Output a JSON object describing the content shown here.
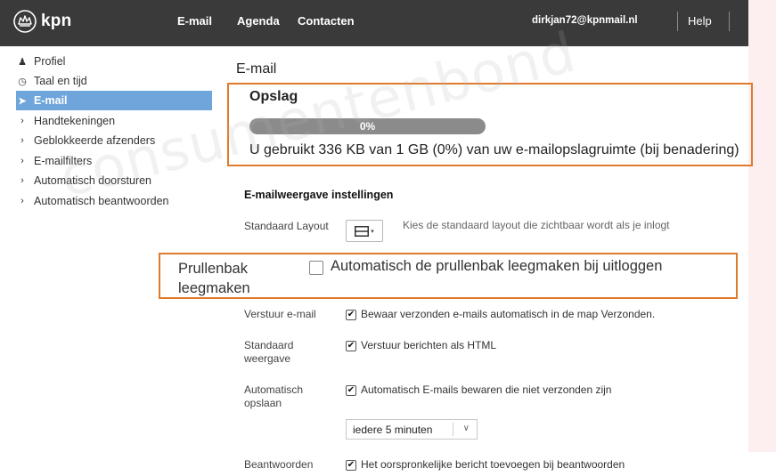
{
  "header": {
    "logo_text": "kpn",
    "nav": [
      "E-mail",
      "Agenda",
      "Contacten"
    ],
    "user_email": "dirkjan72@kpnmail.nl",
    "help_label": "Help"
  },
  "sidebar": {
    "items": [
      {
        "label": "Profiel",
        "icon": "user-icon",
        "glyph": "♟"
      },
      {
        "label": "Taal en tijd",
        "icon": "clock-icon",
        "glyph": "◷"
      },
      {
        "label": "E-mail",
        "icon": "send-icon",
        "glyph": "➤",
        "active": true
      },
      {
        "label": "Handtekeningen",
        "icon": "chevron-right-icon",
        "glyph": "›"
      },
      {
        "label": "Geblokkeerde afzenders",
        "icon": "chevron-right-icon",
        "glyph": "›"
      },
      {
        "label": "E-mailfilters",
        "icon": "chevron-right-icon",
        "glyph": "›"
      },
      {
        "label": "Automatisch doorsturen",
        "icon": "chevron-right-icon",
        "glyph": "›"
      },
      {
        "label": "Automatisch beantwoorden",
        "icon": "chevron-right-icon",
        "glyph": "›"
      }
    ],
    "active_color": "#6ea5da"
  },
  "main": {
    "title": "E-mail",
    "storage": {
      "title": "Opslag",
      "percent_label": "0%",
      "percent_value": 0,
      "usage_text": "U gebruikt 336 KB van 1 GB (0%) van uw e-mailopslagruimte (bij benadering)"
    },
    "settings_title": "E-mailweergave instellingen",
    "layout": {
      "label": "Standaard Layout",
      "hint": "Kies de standaard layout die zichtbaar wordt als je inlogt"
    },
    "trash": {
      "label": "Prullenbak leegmaken",
      "checkbox_label": "Automatisch de prullenbak leegmaken bij uitloggen",
      "checked": false
    },
    "send": {
      "label": "Verstuur e-mail",
      "checkbox_label": "Bewaar verzonden e-mails automatisch in de map Verzonden.",
      "checked": true
    },
    "view": {
      "label": "Standaard weergave",
      "checkbox_label": "Verstuur berichten als HTML",
      "checked": true
    },
    "autosave": {
      "label": "Automatisch opslaan",
      "checkbox_label": "Automatisch E-mails bewaren die niet verzonden zijn",
      "checked": true,
      "interval_value": "iedere 5 minuten"
    },
    "reply": {
      "label": "Beantwoorden",
      "checkbox_label": "Het oorspronkelijke bericht toevoegen bij beantwoorden",
      "checked": true
    }
  },
  "watermark": "consumentenbond",
  "colors": {
    "header": "#3a3a3a",
    "highlight": "#e07a2d",
    "progress": "#8b8b8b"
  }
}
